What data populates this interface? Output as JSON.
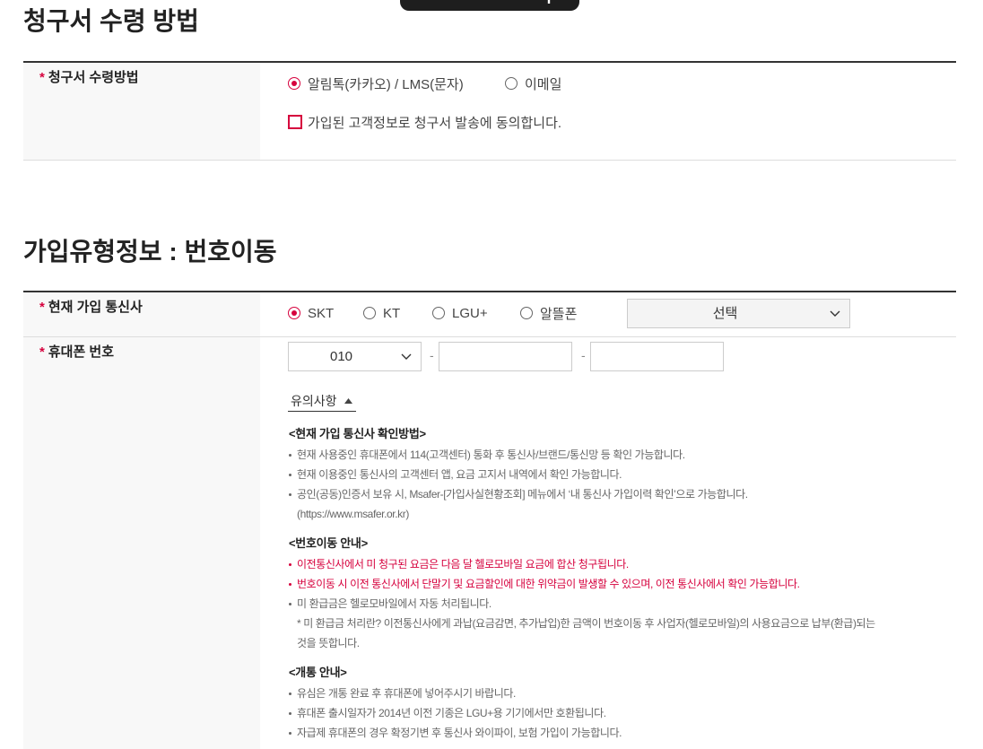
{
  "floating_toggle": {
    "icon": "plus-icon"
  },
  "billing": {
    "title": "청구서 수령 방법",
    "row": {
      "required_mark": "*",
      "label": "청구서 수령방법",
      "options": [
        {
          "label": "알림톡(카카오) / LMS(문자)",
          "selected": true
        },
        {
          "label": "이메일",
          "selected": false
        }
      ],
      "consent": {
        "label": "가입된 고객정보로 청구서 발송에 동의합니다.",
        "checked": false
      }
    }
  },
  "join_type": {
    "title": "가입유형정보 : 번호이동",
    "carrier_row": {
      "required_mark": "*",
      "label": "현재 가입 통신사",
      "options": [
        {
          "label": "SKT",
          "selected": true
        },
        {
          "label": "KT",
          "selected": false
        },
        {
          "label": "LGU+",
          "selected": false
        },
        {
          "label": "알뜰폰",
          "selected": false
        }
      ],
      "select": {
        "value": "선택",
        "icon": "chevron-down-icon"
      }
    },
    "phone_row": {
      "required_mark": "*",
      "label": "휴대폰 번호",
      "prefix_select": {
        "value": "010",
        "icon": "chevron-down-icon"
      },
      "separator": "-",
      "middle_input": {
        "value": ""
      },
      "last_input": {
        "value": ""
      },
      "notice_toggle": {
        "label": "유의사항",
        "icon": "caret-up-icon",
        "expanded": true
      },
      "notice": {
        "groups": [
          {
            "heading": "<현재 가입 통신사 확인방법>",
            "lines": [
              "현재 사용중인 휴대폰에서 114(고객센터) 통화 후 통신사/브랜드/통신망 등 확인 가능합니다.",
              "현재 이용중인 통신사의 고객센터 앱, 요금 고지서 내역에서 확인 가능합니다.",
              "공인(공동)인증서 보유 시, Msafer-[가입사실현황조회] 메뉴에서 ‘내 통신사 가입이력 확인’으로 가능합니다.",
              "(https://www.msafer.or.kr)"
            ]
          },
          {
            "heading": "<번호이동 안내>",
            "lines": [
              "이전통신사에서 미 청구된 요금은 다음 달 헬로모바일 요금에 합산 청구됩니다.",
              "번호이동 시 이전 통신사에서 단말기 및 요금할인에 대한 위약금이 발생할 수 있으며, 이전 통신사에서 확인 가능합니다.",
              "미 환급금은 헬로모바일에서 자동 처리됩니다.",
              "* 미 환급금 처리란? 이전통신사에게 과납(요금감면, 추가납입)한 금액이 번호이동 후 사업자(헬로모바일)의 사용요금으로 납부(환급)되는",
              "것을 뜻합니다."
            ]
          },
          {
            "heading": "<개통 안내>",
            "lines": [
              "유심은 개통 완료 후 휴대폰에 넣어주시기 바랍니다.",
              "휴대폰 출시일자가 2014년 이전 기종은 LGU+용 기기에서만 호환됩니다.",
              "자급제 휴대폰의 경우 확정기변 후 통신사 와이파이, 보험 가입이 가능합니다."
            ]
          }
        ]
      }
    }
  },
  "colors": {
    "accent": "#d6003d",
    "text": "#222222",
    "muted": "#666666",
    "rule": "#333333",
    "border": "#dddddd",
    "field_border": "#cccccc",
    "label_bg": "#f8f8f8",
    "pill_bg": "#1e1e1e"
  }
}
